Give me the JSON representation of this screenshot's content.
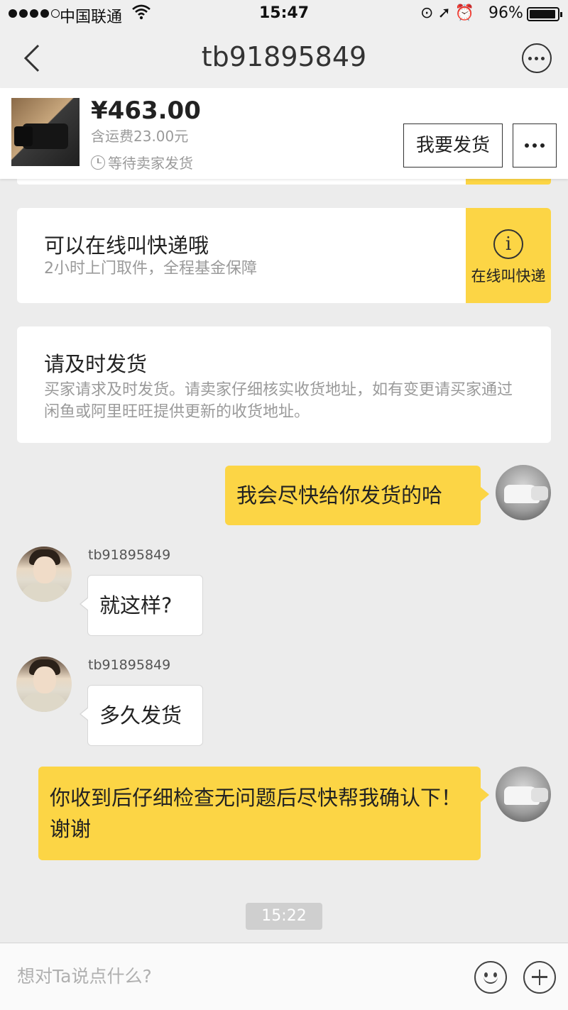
{
  "status_bar": {
    "carrier": "中国联通",
    "time": "15:47",
    "battery_percent": "96%",
    "battery_level": 0.96,
    "signal_bars": 4,
    "icons": [
      "signal-icon",
      "wifi-icon",
      "orientation-lock-icon",
      "location-icon",
      "alarm-icon",
      "battery-icon"
    ]
  },
  "nav": {
    "title": "tb91895849",
    "icons": [
      "back-icon",
      "more-icon"
    ]
  },
  "order": {
    "price": "¥463.00",
    "shipping": "含运费23.00元",
    "status": "等待卖家发货",
    "ship_button": "我要发货"
  },
  "cards": {
    "courier_title": "可以在线叫快递哦",
    "courier_desc": "2小时上门取件，全程基金保障",
    "courier_action": "在线叫快递",
    "remind_title": "请及时发货",
    "remind_desc": "买家请求及时发货。请卖家仔细核实收货地址，如有变更请买家通过闲鱼或阿里旺旺提供更新的收货地址。"
  },
  "messages": [
    {
      "direction": "out",
      "text": "我会尽快给你发货的哈"
    },
    {
      "direction": "in",
      "sender": "tb91895849",
      "text": "就这样?"
    },
    {
      "direction": "in",
      "sender": "tb91895849",
      "text": "多久发货"
    },
    {
      "direction": "out",
      "text": "你收到后仔细检查无问题后尽快帮我确认下！谢谢"
    }
  ],
  "timestamp": "15:22",
  "input": {
    "placeholder": "想对Ta说点什么?",
    "value": ""
  },
  "colors": {
    "accent": "#fcd545",
    "background": "#ececec"
  }
}
